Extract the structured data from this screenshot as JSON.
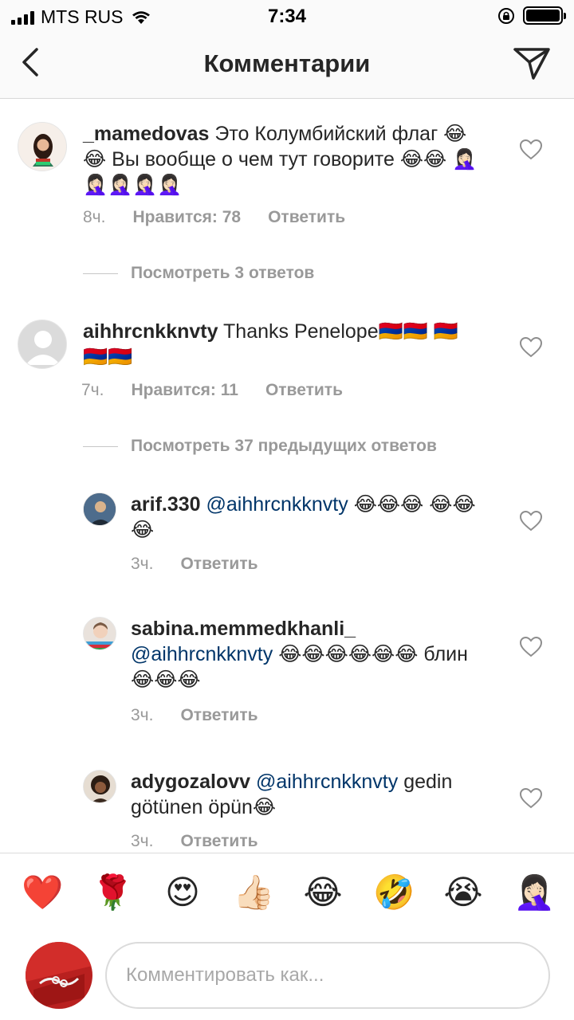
{
  "status_bar": {
    "carrier": "MTS RUS",
    "time": "7:34"
  },
  "nav": {
    "title": "Комментарии",
    "back_icon": "chevron-left-icon",
    "send_icon": "paper-plane-icon"
  },
  "comments": [
    {
      "username": "_mamedovas",
      "text": "Это Колумбийский флаг 😂😂 Вы вообще о чем тут говорите 😂😂 🤦🏻‍♀️🤦🏻‍♀️🤦🏻‍♀️🤦🏻‍♀️🤦🏻‍♀️",
      "time": "8ч.",
      "likes": "Нравится: 78",
      "reply": "Ответить",
      "view_replies": "Посмотреть 3 ответов"
    },
    {
      "username": "aihhrcnkknvty",
      "text": "Thanks Penelope🇦🇲🇦🇲 🇦🇲🇦🇲🇦🇲",
      "time": "7ч.",
      "likes": "Нравится: 11",
      "reply": "Ответить",
      "view_replies": "Посмотреть 37 предыдущих ответов"
    }
  ],
  "replies": [
    {
      "username": "arif.330",
      "mention": "@aihhrcnkknvty",
      "text": "😂😂😂 😂😂😂",
      "time": "3ч.",
      "reply": "Ответить"
    },
    {
      "username": "sabina.memmedkhanli_",
      "mention": "@aihhrcnkknvty",
      "text": "😂😂😂😂😂😂 блин 😂😂😂",
      "time": "3ч.",
      "reply": "Ответить"
    },
    {
      "username": "adygozalovv",
      "mention": "@aihhrcnkknvty",
      "text": "gedin götünen öpün😂",
      "time": "3ч.",
      "reply": "Ответить"
    }
  ],
  "emoji_bar": [
    "❤️",
    "🌹",
    "😍",
    "👍🏻",
    "😂",
    "🤣",
    "😭",
    "🤦🏻‍♀️"
  ],
  "input": {
    "placeholder": "Комментировать как..."
  },
  "colors": {
    "mention": "#003569",
    "meta": "#999999",
    "text": "#262626",
    "heart_red": "#ed1c24"
  }
}
